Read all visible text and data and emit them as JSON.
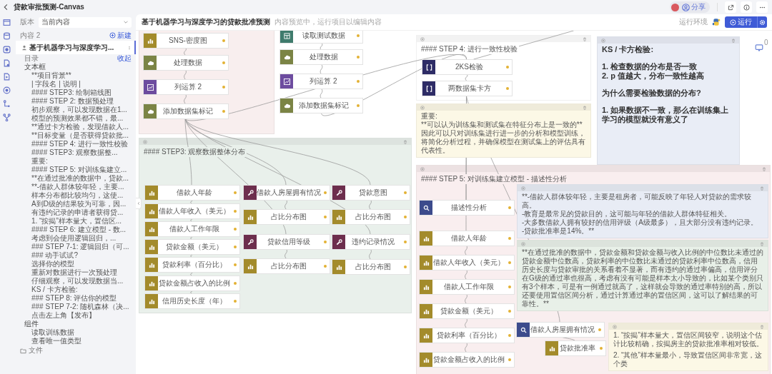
{
  "app": {
    "title": "贷款审批预测-Canvas",
    "share_button": "分享"
  },
  "sidebar": {
    "version_label": "版本",
    "version_value": "当前内容",
    "content_label": "内容 2",
    "new_button": "新建",
    "documents": [
      {
        "label": "基于机器学习与深度学习...",
        "selected": true
      }
    ],
    "toc_label": "目录",
    "collapse_link": "收起",
    "outline": [
      {
        "label": "文本框",
        "children": [
          {
            "label": "**项目背景**"
          },
          {
            "label": "| 字段名 | 说明 |"
          },
          {
            "label": "#### STEP3: 绘制箱线图"
          },
          {
            "label": "#### STEP 2: 数据预处理"
          },
          {
            "label": "初步观察，可以发现数据在1..."
          },
          {
            "label": "模型的预测效果都不错，最..."
          },
          {
            "label": "**通过卡方检验，发现借款人..."
          },
          {
            "label": "**目标变量（是否获得贷款批..."
          },
          {
            "label": "#### STEP 4: 进行一致性校验"
          },
          {
            "label": "#### STEP3: 观察数据整..."
          },
          {
            "label": "重要:"
          },
          {
            "label": "#### STEP 5: 对训练集建立..."
          },
          {
            "label": "**在通过批准的数据中，贷款..."
          },
          {
            "label": "**-借款人群体较年轻，主要..."
          },
          {
            "label": "样本分布都比较均匀，这使..."
          },
          {
            "label": "A到D级的结果较为可靠，因..."
          },
          {
            "label": "有违约记录的申请者获得贷..."
          },
          {
            "label": "1. “按揭”样本量大，置信区..."
          },
          {
            "label": "#### STEP 6: 建立模型 - 数..."
          },
          {
            "label": "考虑到会使用逻辑回归，..."
          },
          {
            "label": "### STEP 7-1: 逻辑回归（可..."
          },
          {
            "label": "### 动手试试?"
          },
          {
            "label": "选择你的模型"
          },
          {
            "label": "重新对数据进行一次预处理"
          },
          {
            "label": "仔细观察，可以发现数据当..."
          },
          {
            "label": "KS / 卡方检验:"
          },
          {
            "label": "### STEP 8: 评估你的模型"
          },
          {
            "label": "### STEP 7-2: 随机森林（决..."
          },
          {
            "label": "点击左上角【发布】"
          }
        ]
      },
      {
        "label": "组件",
        "children": [
          {
            "label": "读取训练数据"
          },
          {
            "label": "查看唯一值类型"
          }
        ]
      }
    ],
    "files_label": "文件"
  },
  "canvas": {
    "title": "基于机器学习与深度学习的贷款批准预测",
    "subtitle": "内容预览中，运行项目以编辑内容",
    "env_label": "运行环境",
    "run_button": "运行",
    "comment_count": "0",
    "blocks": [
      {
        "kind": "group",
        "color": "#f8eeee",
        "items": [
          {
            "kind": "chart",
            "label": "SNS-密度图"
          },
          {
            "kind": "process",
            "label": "处理数据"
          },
          {
            "kind": "column",
            "label": "列运算 2"
          },
          {
            "kind": "process",
            "label": "添加数据集标记"
          }
        ]
      },
      {
        "kind": "plain",
        "items": [
          {
            "kind": "read",
            "label": "读取测试数据"
          },
          {
            "kind": "process",
            "label": "处理数据"
          },
          {
            "kind": "column",
            "label": "列运算 2"
          },
          {
            "kind": "process",
            "label": "添加数据集标记"
          }
        ]
      },
      {
        "kind": "panel",
        "color": "#ffffff",
        "title": "#### STEP 4: 进行一致性校验",
        "items": [
          {
            "kind": "test",
            "label": "2KS检验"
          },
          {
            "kind": "test",
            "label": "两数据集卡方"
          }
        ]
      },
      {
        "kind": "note",
        "color": "#fcf8e6",
        "bold": false,
        "paragraphs": [
          [
            "重要:",
            "**可以认为训练集和测试集在特征分布上是一致的**",
            "因此可以只对训练集进行进一步的分析和模型训练，将简化分析过程，并确保模型在测试集上的评估具有代表性。"
          ]
        ]
      },
      {
        "kind": "note",
        "color": "#e9edf6",
        "bold": true,
        "paragraphs": [
          [
            "KS / 卡方检验:"
          ],
          [
            "1. 检查数据的分布是否一致",
            "2. p 值越大，分布一致性越高"
          ],
          [
            "为什么需要检验数据的分布?"
          ],
          [
            "1. 如果数据不一致，那么在训练集上学习的模型就没有意义了"
          ]
        ]
      },
      {
        "kind": "group",
        "color": "#e9f0eb",
        "title": "#### STEP3: 观察数据整体分布",
        "items": [
          {
            "kind": "chart",
            "label": "借款人年龄"
          },
          {
            "kind": "chart",
            "label": "借款人年收入（美元）"
          },
          {
            "kind": "chart",
            "label": "借款人工作年限"
          },
          {
            "kind": "chart",
            "label": "贷款金额（美元）"
          },
          {
            "kind": "chart",
            "label": "贷款利率（百分比）"
          },
          {
            "kind": "chart",
            "label": "贷款金额占收入的比例"
          },
          {
            "kind": "chart",
            "label": "信用历史长度（年）"
          },
          {
            "kind": "tool",
            "label": "借款人房屋拥有情况"
          },
          {
            "kind": "chart",
            "label": "占比分布图"
          },
          {
            "kind": "tool",
            "label": "贷款信用等级"
          },
          {
            "kind": "chart",
            "label": "占比分布图"
          },
          {
            "kind": "tool",
            "label": "贷款意图"
          },
          {
            "kind": "chart",
            "label": "占比分布图"
          },
          {
            "kind": "tool",
            "label": "违约记录情况"
          },
          {
            "kind": "chart",
            "label": "占比分布图"
          }
        ]
      },
      {
        "kind": "group",
        "color": "#f9eeef",
        "title": "#### STEP 5: 对训练集建立模型 - 描述性分析",
        "items": [
          {
            "kind": "analysis",
            "label": "描述性分析"
          },
          {
            "kind": "chart",
            "label": "借款人年龄"
          },
          {
            "kind": "chart",
            "label": "借款人年收入（美元）"
          },
          {
            "kind": "chart",
            "label": "借款人工作年限"
          },
          {
            "kind": "chart",
            "label": "贷款金额（美元）"
          },
          {
            "kind": "chart",
            "label": "贷款利率（百分比）"
          },
          {
            "kind": "chart",
            "label": "贷款金额占收入的比例"
          },
          {
            "kind": "note",
            "color": "#e8ecf5",
            "bold": false,
            "paragraphs": [
              [
                "**-借款人群体较年轻，主要是租房者，可能反映了年轻人对贷款的需求较高。",
                "-教育是最常见的贷款目的，这可能与年轻的借款人群体特征相关。",
                "-大多数借款人拥有较好的信用评级（A级最多），且大部分没有违约记录。",
                "-贷款批准率是14%。**"
              ]
            ]
          },
          {
            "kind": "note",
            "color": "#e8f0e8",
            "bold": false,
            "paragraphs": [
              [
                "**在通过批准的数据中，贷款金额和贷款金额与收入比例的中位数比未通过的贷款金额中位数高，贷款利率的中位数比未通过的贷款利率中位数高，信用历史长度与贷款审批的关系看着不显著，而有违约的通过率偏高，信用评分在G级的通过率也很高，考虑有没有可能是样本太小导致的，比如某个类别只有3个样本，可是有一例通过就高了，这样就会导致的通过率特别的高，所以还要使用置信区间分析，通过计算通过率的置信区间，这可以了解结果的可靠性。**"
              ]
            ]
          },
          {
            "kind": "analysis",
            "label": "借款人房屋拥有情况"
          },
          {
            "kind": "chart",
            "label": "贷款批准率"
          },
          {
            "kind": "note",
            "color": "#fcf8e6",
            "bold": false,
            "paragraphs": [
              [
                "1. “按揭”样本量大，置信区间较窄，说明这个估计比较精确，按揭房主的贷款批准率相对较低。"
              ],
              [
                "2. “其他”样本量最小，导致置信区间非常宽，这个类"
              ]
            ]
          }
        ]
      }
    ]
  }
}
